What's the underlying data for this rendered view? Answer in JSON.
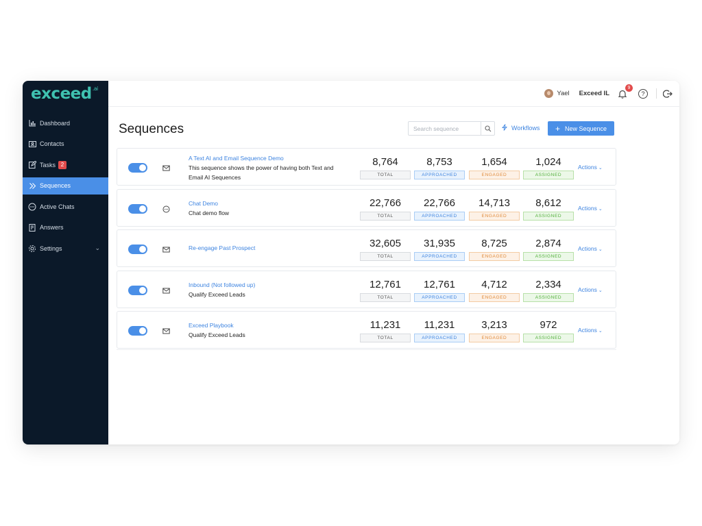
{
  "brand": {
    "logo": "exceed",
    "logo_suffix": ".ai",
    "accent": "#4a8fe7",
    "sidebar_bg": "#0b1929"
  },
  "sidebar": {
    "items": [
      {
        "label": "Dashboard",
        "icon": "chart-icon"
      },
      {
        "label": "Contacts",
        "icon": "contact-card-icon"
      },
      {
        "label": "Tasks",
        "icon": "edit-icon",
        "badge": "2"
      },
      {
        "label": "Sequences",
        "icon": "double-chevron-icon",
        "active": true
      },
      {
        "label": "Active Chats",
        "icon": "chat-bubble-icon"
      },
      {
        "label": "Answers",
        "icon": "book-icon"
      },
      {
        "label": "Settings",
        "icon": "gear-icon"
      }
    ]
  },
  "topbar": {
    "user_name": "Yael",
    "org_name": "Exceed IL",
    "notification_count": "9",
    "help_symbol": "?"
  },
  "main": {
    "title": "Sequences",
    "search_placeholder": "Search sequence",
    "workflows_label": "Workflows",
    "new_sequence_label": "New Sequence"
  },
  "stat_labels": {
    "total": "TOTAL",
    "approached": "APPROACHED",
    "engaged": "ENGAGED",
    "assigned": "ASSIGNED"
  },
  "actions_label": "Actions",
  "sequences": [
    {
      "name": "A Text AI and Email Sequence Demo",
      "desc1": "This sequence shows the power of having both Text and",
      "desc2": "Email AI Sequences",
      "type": "email-icon",
      "enabled": true,
      "total": "8,764",
      "approached": "8,753",
      "engaged": "1,654",
      "assigned": "1,024"
    },
    {
      "name": "Chat Demo",
      "desc1": "Chat demo flow",
      "desc2": "",
      "type": "chat-icon",
      "enabled": true,
      "total": "22,766",
      "approached": "22,766",
      "engaged": "14,713",
      "assigned": "8,612"
    },
    {
      "name": "Re-engage Past Prospect",
      "desc1": "",
      "desc2": "",
      "type": "email-icon",
      "enabled": true,
      "total": "32,605",
      "approached": "31,935",
      "engaged": "8,725",
      "assigned": "2,874"
    },
    {
      "name": "Inbound (Not followed up)",
      "desc1": "Qualify Exceed Leads",
      "desc2": "",
      "type": "email-icon",
      "enabled": true,
      "total": "12,761",
      "approached": "12,761",
      "engaged": "4,712",
      "assigned": "2,334"
    },
    {
      "name": "Exceed Playbook",
      "desc1": "Qualify Exceed Leads",
      "desc2": "",
      "type": "email-icon",
      "enabled": true,
      "total": "11,231",
      "approached": "11,231",
      "engaged": "3,213",
      "assigned": "972"
    }
  ]
}
